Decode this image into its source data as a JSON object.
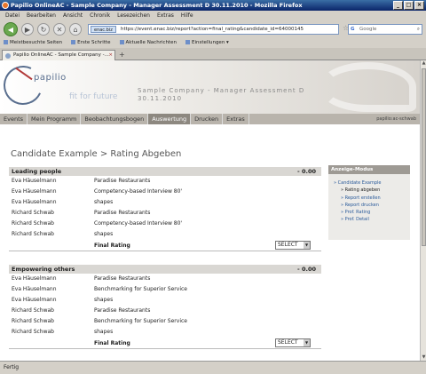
{
  "window": {
    "title": "Papilio OnlineAC - Sample Company - Manager Assessment D 30.11.2010 - Mozilla Firefox"
  },
  "menu": [
    "Datei",
    "Bearbeiten",
    "Ansicht",
    "Chronik",
    "Lesezeichen",
    "Extras",
    "Hilfe"
  ],
  "navbar": {
    "site": "enac.biz",
    "url": "https://event.enac.biz/report?action=final_rating&candidate_id=64000145",
    "search_placeholder": "Google"
  },
  "bookmarks": [
    "Meistbesuchte Seiten",
    "Erste Schritte",
    "Aktuelle Nachrichten",
    "Einstellungen ▾"
  ],
  "tab": {
    "label": "Papilio OnlineAC - Sample Company -..."
  },
  "header": {
    "logo": "papilio",
    "tagline": "fit for future",
    "company_line1": "Sample Company - Manager Assessment D",
    "company_line2": "30.11.2010"
  },
  "mainnav": {
    "items": [
      "Events",
      "Mein Programm",
      "Beobachtungsbogen",
      "Auswertung",
      "Drucken",
      "Extras"
    ],
    "active": "Auswertung",
    "user": "papilio:ac-schwab"
  },
  "page": {
    "title": "Candidate Example > Rating Abgeben"
  },
  "sections": [
    {
      "title": "Leading people",
      "score": "- 0.00",
      "rows": [
        {
          "name": "Eva Häuselmann",
          "activity": "Paradise Restaurants"
        },
        {
          "name": "Eva Häuselmann",
          "activity": "Competency-based Interview 80'"
        },
        {
          "name": "Eva Häuselmann",
          "activity": "shapes"
        },
        {
          "name": "Richard Schwab",
          "activity": "Paradise Restaurants"
        },
        {
          "name": "Richard Schwab",
          "activity": "Competency-based Interview 80'"
        },
        {
          "name": "Richard Schwab",
          "activity": "shapes"
        }
      ],
      "final_label": "Final Rating",
      "select": "SELECT"
    },
    {
      "title": "Empowering others",
      "score": "- 0.00",
      "rows": [
        {
          "name": "Eva Häuselmann",
          "activity": "Paradise Restaurants"
        },
        {
          "name": "Eva Häuselmann",
          "activity": "Benchmarking for Superior Service"
        },
        {
          "name": "Eva Häuselmann",
          "activity": "shapes"
        },
        {
          "name": "Richard Schwab",
          "activity": "Paradise Restaurants"
        },
        {
          "name": "Richard Schwab",
          "activity": "Benchmarking for Superior Service"
        },
        {
          "name": "Richard Schwab",
          "activity": "shapes"
        }
      ],
      "final_label": "Final Rating",
      "select": "SELECT"
    }
  ],
  "sidebar": {
    "title": "Anzeige-Modus",
    "items": [
      "Candidate Example",
      "Rating abgeben",
      "Report erstellen",
      "Report drucken",
      "Prof. Rating",
      "Prof. Detail"
    ]
  },
  "status": {
    "text": "Fertig"
  }
}
